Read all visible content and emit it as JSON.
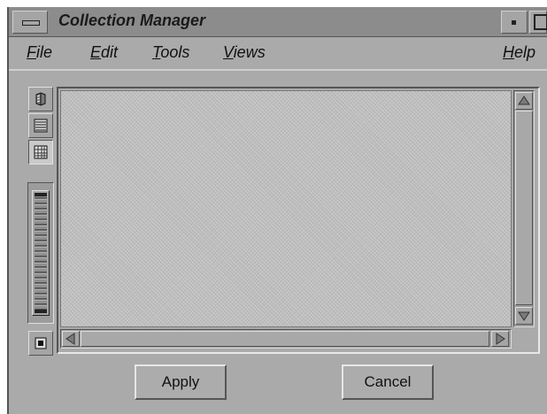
{
  "window": {
    "title": "Collection Manager"
  },
  "menubar": {
    "items": [
      {
        "mnemonic": "F",
        "rest": "ile"
      },
      {
        "mnemonic": "E",
        "rest": "dit"
      },
      {
        "mnemonic": "T",
        "rest": "ools"
      },
      {
        "mnemonic": "V",
        "rest": "iews"
      },
      {
        "mnemonic": "H",
        "rest": "elp"
      }
    ]
  },
  "toolbar": {
    "icons": [
      "container-icon",
      "list-view-icon",
      "column-view-icon",
      "zoom-slider",
      "toggle-icon"
    ],
    "active_view": "column-view"
  },
  "buttons": {
    "apply": "Apply",
    "cancel": "Cancel"
  },
  "colors": {
    "window_bg": "#aaaaaa",
    "titlebar": "#8c8c8c",
    "view_bg": "#bdbdbd"
  }
}
